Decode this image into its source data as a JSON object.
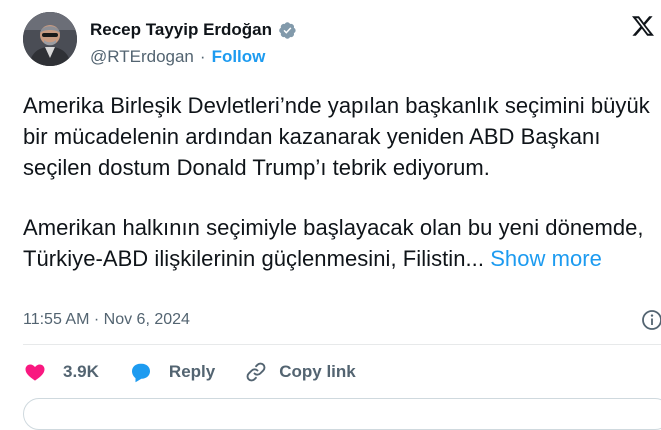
{
  "author": {
    "display_name": "Recep Tayyip Erdoğan",
    "handle": "@RTErdogan",
    "separator": "·",
    "follow_label": "Follow",
    "verified_color": "#829aab"
  },
  "tweet": {
    "paragraph_1": "Amerika Birleşik Devletleri’nde yapılan başkanlık seçimini büyük bir mücadelenin ardından kazanarak yeniden ABD Başkanı seçilen dostum Donald Trump’ı tebrik ediyorum.",
    "paragraph_2": "Amerikan halkının seçimiyle başlayacak olan bu yeni dönemde, Türkiye-ABD ilişkilerinin güçlenmesini, Filistin...",
    "show_more_label": "Show more"
  },
  "meta": {
    "time": "11:55 AM",
    "separator": "·",
    "date": "Nov 6, 2024"
  },
  "actions": {
    "like_count": "3.9K",
    "reply_label": "Reply",
    "copy_link_label": "Copy link"
  },
  "colors": {
    "accent": "#1d9bf0",
    "like": "#f91880",
    "muted": "#536471"
  },
  "icons": [
    "verified-badge-icon",
    "x-logo-icon",
    "info-icon",
    "heart-icon",
    "reply-bubble-icon",
    "link-icon"
  ]
}
